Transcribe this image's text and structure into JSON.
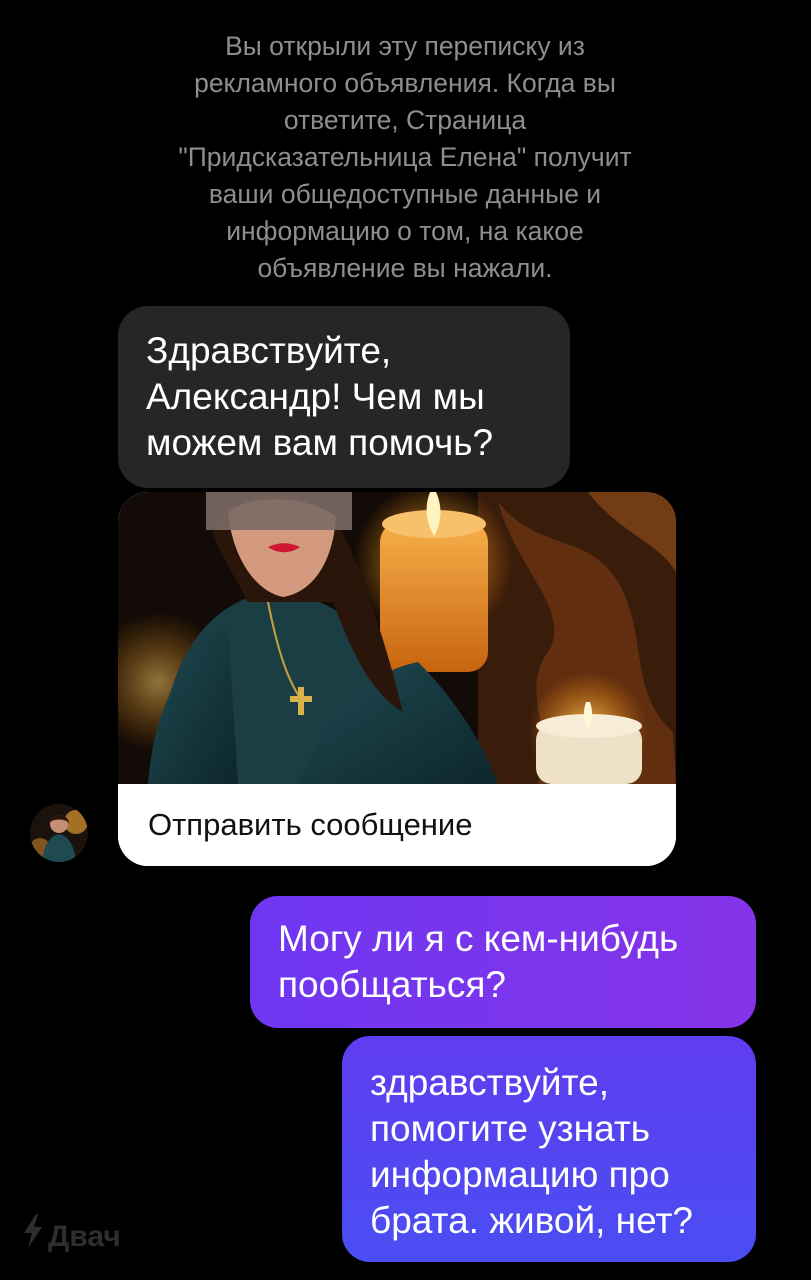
{
  "notice": {
    "lines": [
      "Вы открыли эту переписку из",
      "рекламного объявления. Когда вы",
      "ответите, Страница",
      "\"Придсказательница Елена\" получит",
      "ваши общедоступные данные и",
      "информацию о том, на какое",
      "объявление вы нажали."
    ]
  },
  "messages": {
    "incoming": {
      "lines": [
        "Здравствуйте,",
        "Александр! Чем мы",
        "можем вам помочь?"
      ]
    },
    "ad_card": {
      "button_label": "Отправить сообщение"
    },
    "outgoing_1": {
      "lines": [
        "Могу ли я с кем-нибудь",
        "пообщаться?"
      ]
    },
    "outgoing_2": {
      "lines": [
        "здравствуйте,",
        "помогите узнать",
        "информацию про",
        "брата. живой, нет?"
      ]
    }
  },
  "watermark": {
    "text": "Двач",
    "icon": "lightning-icon"
  },
  "colors": {
    "background": "#000000",
    "incoming_bubble": "#262626",
    "outgoing_gradient_start": "#6f36f2",
    "outgoing_gradient_end": "#4a4ef2",
    "notice_text": "#8e8e8e"
  }
}
